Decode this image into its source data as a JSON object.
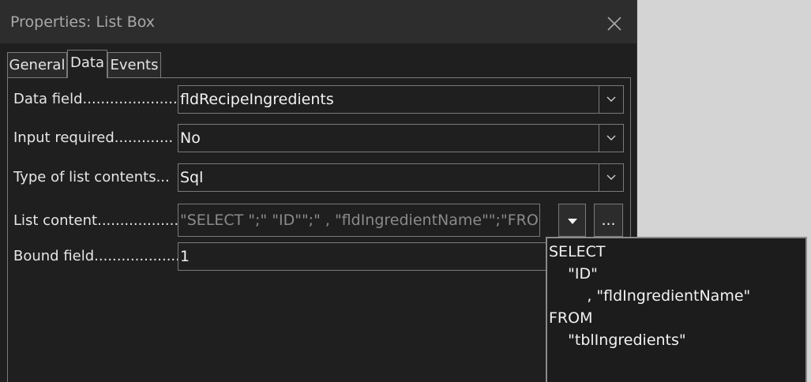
{
  "window": {
    "title": "Properties: List Box",
    "close_icon": "close-icon"
  },
  "tabs": [
    {
      "label": "General"
    },
    {
      "label": "Data",
      "active": true
    },
    {
      "label": "Events"
    }
  ],
  "fields": {
    "data_field": {
      "label": "Data field......................",
      "value": "fldRecipeIngredients"
    },
    "input_required": {
      "label": "Input required.............",
      "value": "No"
    },
    "list_type": {
      "label": "Type of list contents...",
      "value": "Sql"
    },
    "list_content": {
      "label": "List content..................",
      "value": "\"SELECT \";\" \"ID\"\";\"       , \"fldIngredientName\"\";\"FROM"
    },
    "bound_field": {
      "label": "Bound field....................",
      "value": "1"
    }
  },
  "buttons": {
    "dropdown_icon": "triangle-down-icon",
    "more_label": "..."
  },
  "popup": {
    "lines": [
      "SELECT",
      "    \"ID\"",
      "        , \"fldIngredientName\"",
      "FROM",
      "    \"tblIngredients\""
    ]
  },
  "colors": {
    "dialog_bg": "#1f1f1f",
    "titlebar_bg": "#2d2d2d",
    "border": "#7a7a7a"
  }
}
